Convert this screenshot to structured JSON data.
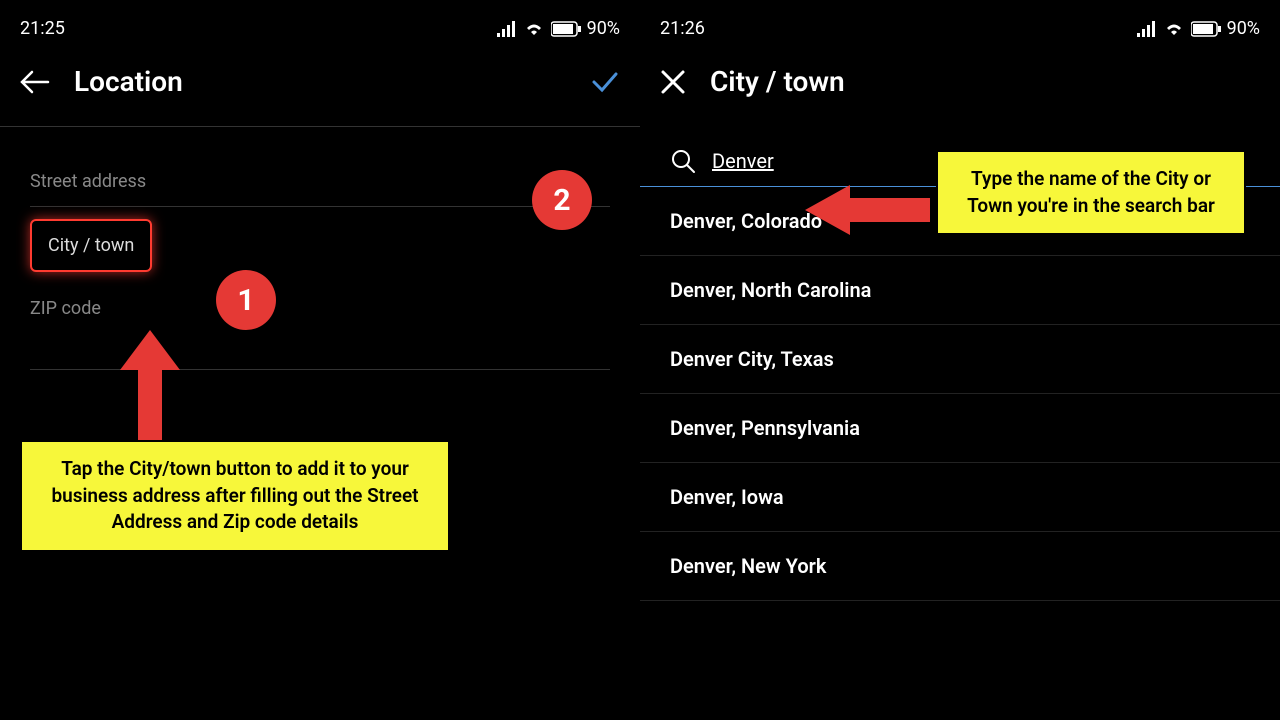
{
  "left": {
    "time": "21:25",
    "battery": "90%",
    "header_title": "Location",
    "street_label": "Street address",
    "city_town_label": "City / town",
    "zip_label": "ZIP code"
  },
  "right": {
    "time": "21:26",
    "battery": "90%",
    "header_title": "City / town",
    "search_value": "Denver",
    "results": [
      "Denver, Colorado",
      "Denver, North Carolina",
      "Denver City, Texas",
      "Denver, Pennsylvania",
      "Denver, Iowa",
      "Denver, New York"
    ]
  },
  "annotations": {
    "badge1": "1",
    "badge2": "2",
    "callout1": "Tap the City/town button to add it to your business address after filling out the Street Address and Zip code details",
    "callout2": "Type the name of the City or Town you're in the search bar"
  }
}
